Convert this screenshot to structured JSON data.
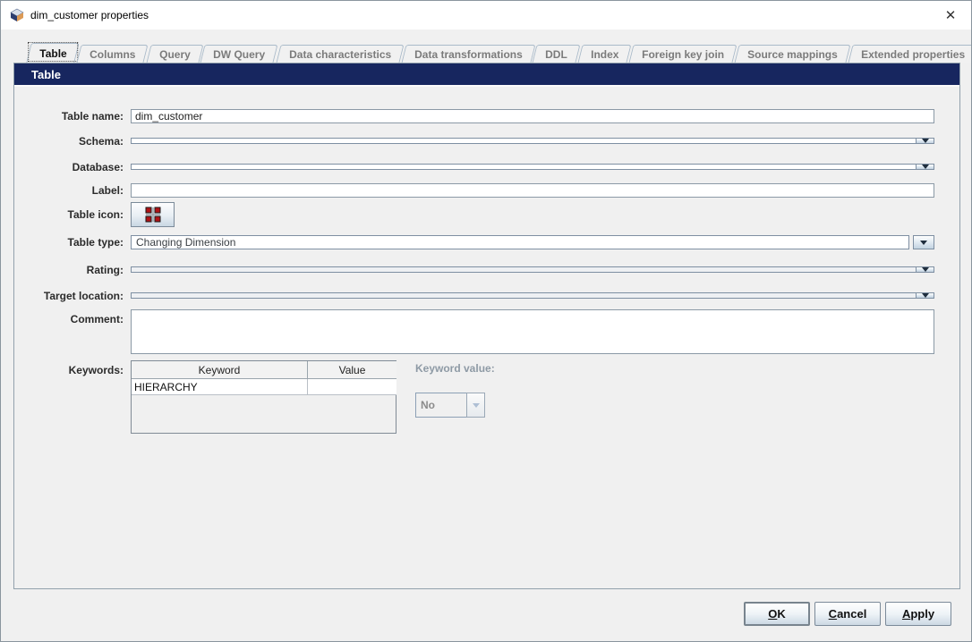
{
  "window": {
    "title": "dim_customer properties"
  },
  "icons": {
    "app_icon": "cube",
    "close_icon": "✕",
    "dropdown_icon": "▼",
    "table_icon_glyph": "dimension-grid"
  },
  "tabs": [
    {
      "label": "Table",
      "selected": true
    },
    {
      "label": "Columns",
      "selected": false
    },
    {
      "label": "Query",
      "selected": false
    },
    {
      "label": "DW Query",
      "selected": false
    },
    {
      "label": "Data characteristics",
      "selected": false
    },
    {
      "label": "Data transformations",
      "selected": false
    },
    {
      "label": "DDL",
      "selected": false
    },
    {
      "label": "Index",
      "selected": false
    },
    {
      "label": "Foreign key join",
      "selected": false
    },
    {
      "label": "Source mappings",
      "selected": false
    },
    {
      "label": "Extended properties",
      "selected": false
    }
  ],
  "panel": {
    "header": "Table"
  },
  "form": {
    "table_name": {
      "label": "Table name:",
      "value": "dim_customer"
    },
    "schema": {
      "label": "Schema:",
      "value": ""
    },
    "database": {
      "label": "Database:",
      "value": ""
    },
    "label_field": {
      "label": "Label:",
      "value": ""
    },
    "table_icon": {
      "label": "Table icon:"
    },
    "table_type": {
      "label": "Table type:",
      "value": "Changing Dimension"
    },
    "rating": {
      "label": "Rating:",
      "value": ""
    },
    "target_location": {
      "label": "Target location:",
      "value": ""
    },
    "comment": {
      "label": "Comment:",
      "value": ""
    },
    "keywords": {
      "label": "Keywords:",
      "columns": [
        "Keyword",
        "Value"
      ],
      "rows": [
        {
          "keyword": "HIERARCHY",
          "value": ""
        }
      ]
    },
    "keyword_value": {
      "label": "Keyword value:",
      "value": "No",
      "state": "disabled"
    }
  },
  "buttons": [
    {
      "label": "OK",
      "default": true
    },
    {
      "label": "Cancel",
      "default": false
    },
    {
      "label": "Apply",
      "default": false
    }
  ],
  "colors": {
    "header_bg": "#17265f",
    "header_text": "#ffffff",
    "window_bg": "#f0f0f0",
    "titlebar_bg": "#ffffff",
    "table_icon_red": "#b01216",
    "disabled_text": "#8b8b8b"
  }
}
